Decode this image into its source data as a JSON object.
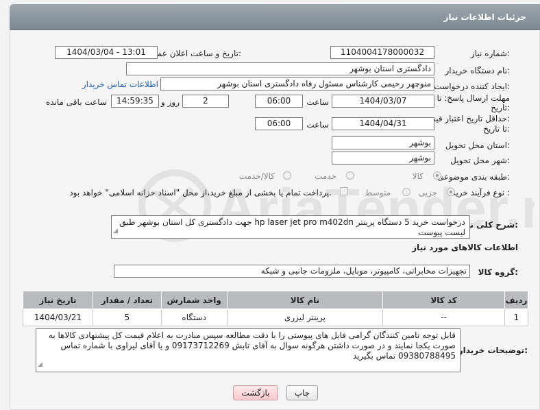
{
  "header": {
    "title": "جزئیات اطلاعات نیاز"
  },
  "fields": {
    "need_number_label": "شماره نیاز:",
    "need_number": "1104004178000032",
    "announce_label": "تاریخ و ساعت اعلان عمومی:",
    "announce_value": "1404/03/04 - 13:01",
    "buyer_org_label": "نام دستگاه خریدار:",
    "buyer_org": "دادگستری استان بوشهر",
    "creator_label": "ایجاد کننده درخواست:",
    "creator": "منوچهر رحیمی کارشناس مسئول رفاه دادگستری استان بوشهر",
    "contact_link": "اطلاعات تماس خریدار",
    "deadline_label_1": "مهلت ارسال پاسخ: تا",
    "deadline_label_2": "تاریخ:",
    "deadline_date": "1404/03/07",
    "time_label": "ساعت",
    "deadline_time": "06:00",
    "days_value": "2",
    "days_label": "روز و",
    "remaining_time": "14:59:35",
    "remaining_label": "ساعت باقی مانده",
    "validity_label_1": "حداقل تاریخ اعتبار قیمت:",
    "validity_label_2": "تا تاریخ:",
    "validity_date": "1404/04/31",
    "validity_time_label": "ساعت",
    "validity_time": "06:00",
    "province_label": "استان محل تحویل:",
    "province": "بوشهر",
    "city_label": "شهر محل تحویل:",
    "city": "بوشهر",
    "category_label": "طبقه بندی موضوعی:",
    "category_options": [
      "کالا",
      "خدمت",
      "کالا/خدمت"
    ],
    "process_label": "نوع فرآیند خرید :",
    "process_options": [
      "جزیی",
      "متوسط"
    ],
    "payment_note": "پرداخت تمام یا بخشی از مبلغ خرید،از محل \"اسناد خزانه اسلامی\" خواهد بود.",
    "summary_label": "شرح کلی نیاز:",
    "summary": "درخواست خرید 5 دستگاه پرینتر hp laser jet pro m402dn جهت دادگستری کل استان بوشهر طبق لیست پیوست",
    "goods_info_title": "اطلاعات کالاهای مورد نیاز",
    "goods_group_label": "گروه کالا:",
    "goods_group": "تجهیزات مخابراتی، کامپیوتر، موبایل، ملزومات جانبی و شبکه"
  },
  "table": {
    "headers": [
      "ردیف",
      "کد کالا",
      "نام کالا",
      "واحد شمارش",
      "تعداد / مقدار",
      "تاریخ نیاز"
    ],
    "rows": [
      [
        "1",
        "--",
        "پرینتر لیزری",
        "دستگاه",
        "5",
        "1404/03/21"
      ]
    ]
  },
  "buyer_notes_label": "توضیحات خریدار:",
  "buyer_notes": "قابل توجه تامین کنندگان گرامی فایل های پیوستی را با دقت مطالعه سپس مبادرت به اعلام قیمت کل پیشنهادی کالاها به صورت یکجا نمایند و در صورت داشتن هرگونه سوال به آقای تابش 09173712269 و یا آقای لیراوی با شماره تماس 09380788495 تماس بگیرید",
  "buttons": {
    "print": "چاپ",
    "back": "بازگشت"
  },
  "watermark_text": "AriaTender.neT",
  "colors": {
    "header": "#8a949c",
    "link": "#1d5fb4",
    "table_header": "#b8bcc0"
  }
}
